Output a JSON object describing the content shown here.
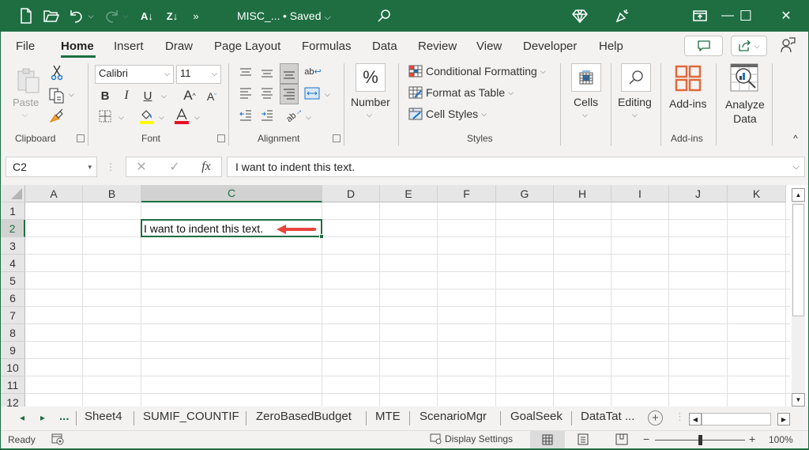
{
  "titlebar": {
    "doc_title": "MISC_...",
    "saved_status": "• Saved",
    "saved_chevron": "⌵",
    "more_commands": "»",
    "minimize": "—",
    "maximize": "☐",
    "close": "✕"
  },
  "menu": {
    "tabs": [
      "File",
      "Home",
      "Insert",
      "Draw",
      "Page Layout",
      "Formulas",
      "Data",
      "Review",
      "View",
      "Developer",
      "Help"
    ],
    "active": "Home"
  },
  "ribbon": {
    "clipboard": {
      "paste": "Paste",
      "label": "Clipboard"
    },
    "font": {
      "name": "Calibri",
      "size": "11",
      "bold": "B",
      "italic": "I",
      "underline": "U",
      "grow": "A",
      "shrink": "A",
      "label": "Font",
      "fill_color": "#ffff00",
      "font_color": "#e81123"
    },
    "alignment": {
      "label": "Alignment",
      "wrap": "ab"
    },
    "number": {
      "symbol": "%",
      "label": "Number"
    },
    "styles": {
      "conditional": "Conditional Formatting",
      "table": "Format as Table",
      "cell_styles": "Cell Styles",
      "label": "Styles"
    },
    "cells": {
      "label": "Cells"
    },
    "editing": {
      "label": "Editing"
    },
    "addins": {
      "button": "Add-ins",
      "label": "Add-ins"
    },
    "analyze": {
      "line1": "Analyze",
      "line2": "Data"
    }
  },
  "formula_bar": {
    "name_box": "C2",
    "fx": "fx",
    "cancel": "✕",
    "enter": "✓",
    "formula": "I want to indent this text."
  },
  "grid": {
    "columns": [
      "A",
      "B",
      "C",
      "D",
      "E",
      "F",
      "G",
      "H",
      "I",
      "J",
      "K"
    ],
    "rows": [
      "1",
      "2",
      "3",
      "4",
      "5",
      "6",
      "7",
      "8",
      "9",
      "10",
      "11",
      "12"
    ],
    "selected_cell": "C2",
    "selected_value": "I want to indent this text.",
    "arrow_color": "#e8453c"
  },
  "sheets": {
    "prev": "◂",
    "next": "▸",
    "more": "...",
    "tabs": [
      "Sheet4",
      "SUMIF_COUNTIF",
      "ZeroBasedBudget",
      "MTE",
      "ScenarioMgr",
      "GoalSeek",
      "DataTat ..."
    ],
    "add": "+"
  },
  "status": {
    "ready": "Ready",
    "display_settings": "Display Settings",
    "zoom_minus": "−",
    "zoom_plus": "+",
    "zoom_level": "100%"
  }
}
